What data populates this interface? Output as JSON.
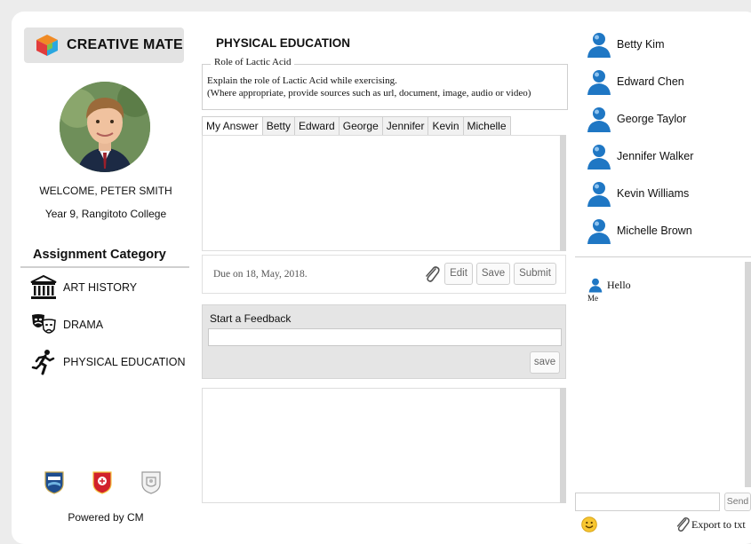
{
  "app": {
    "name": "CREATIVE MATE"
  },
  "profile": {
    "welcome": "WELCOME, PETER SMITH",
    "school_line": "Year 9, Rangitoto College"
  },
  "categories": {
    "title": "Assignment Category",
    "items": [
      {
        "label": "ART HISTORY",
        "icon": "museum-icon"
      },
      {
        "label": "DRAMA",
        "icon": "theater-masks-icon"
      },
      {
        "label": "PHYSICAL EDUCATION",
        "icon": "runner-icon"
      }
    ]
  },
  "footer": {
    "powered": "Powered by CM"
  },
  "assignment": {
    "subject": "PHYSICAL EDUCATION",
    "legend": "Role of Lactic Acid",
    "question_line1": "Explain the role of Lactic Acid while exercising.",
    "question_line2": "(Where appropriate, provide sources such as url, document, image, audio or video)",
    "tabs": [
      "My Answer",
      "Betty",
      "Edward",
      "George",
      "Jennifer",
      "Kevin",
      "Michelle"
    ],
    "due": "Due on 18, May, 2018.",
    "edit_label": "Edit",
    "save_label": "Save",
    "submit_label": "Submit"
  },
  "feedback": {
    "label": "Start a Feedback",
    "input_value": "",
    "save_label": "save"
  },
  "users": [
    "Betty Kim",
    "Edward Chen",
    "George Taylor",
    "Jennifer Walker",
    "Kevin Williams",
    "Michelle Brown"
  ],
  "chat": {
    "messages": [
      {
        "sender": "Me",
        "text": "Hello"
      }
    ],
    "input_value": "",
    "send_label": "Send",
    "export_label": "Export to txt"
  },
  "colors": {
    "user_icon": "#1f77c4",
    "logo_orange": "#f08a24",
    "logo_blue": "#2aa7e0"
  }
}
